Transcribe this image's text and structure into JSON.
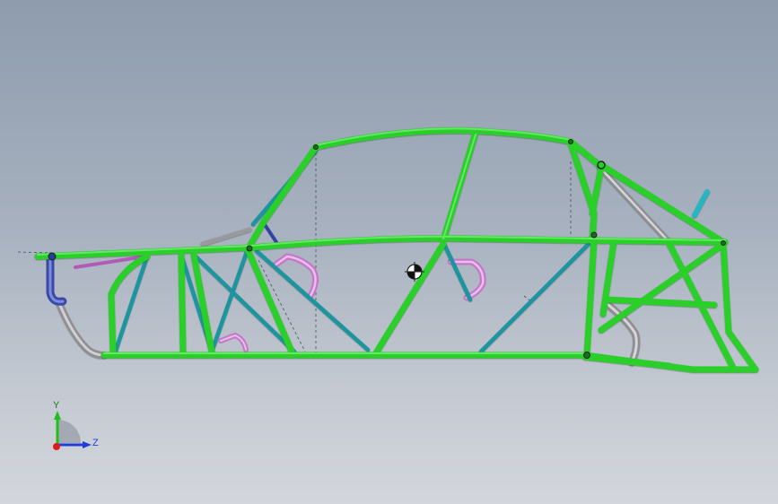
{
  "viewport": {
    "colors": {
      "background_top": "#8e9cae",
      "background_bottom": "#d3d6dc",
      "primary_tube": "#2fd62f",
      "diagonal_tube": "#1d9aa5",
      "accent_tube": "#d98fd9",
      "grey_tube": "#a8a8ac",
      "blue_tube": "#4656b0"
    }
  },
  "triad": {
    "y_label": "Y",
    "z_label": "Z",
    "colors": {
      "y": "#1fbf1f",
      "z": "#1f3fd6",
      "origin": "#e01b1b"
    }
  },
  "center_of_mass": {
    "icon": "center-of-mass-icon"
  }
}
